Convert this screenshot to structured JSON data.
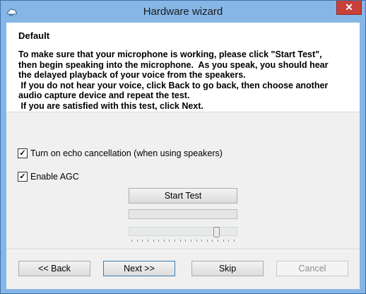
{
  "window": {
    "title": "Hardware wizard",
    "close_label": "✕"
  },
  "page": {
    "heading": "Default",
    "instructions": "To make sure that your microphone is working, please click \"Start Test\",\nthen begin speaking into the microphone.  As you speak, you should hear\nthe delayed playback of your voice from the speakers.\n If you do not hear your voice, click Back to go back, then choose another\naudio capture device and repeat the test.\n If you are satisfied with this test, click Next."
  },
  "options": {
    "echo_cancellation": {
      "label": "Turn on echo cancellation (when using speakers)",
      "checked": true
    },
    "agc": {
      "label": "Enable AGC",
      "checked": true
    }
  },
  "test": {
    "start_label": "Start Test",
    "level_fraction": 0,
    "volume_fraction": 0.83,
    "slider_tick_count": 20
  },
  "nav": {
    "back_label": "<< Back",
    "next_label": "Next >>",
    "skip_label": "Skip",
    "cancel_label": "Cancel"
  },
  "colors": {
    "title_bar": "#86b6e6",
    "close_button": "#c7403a",
    "progress_fill": "#06b025"
  }
}
